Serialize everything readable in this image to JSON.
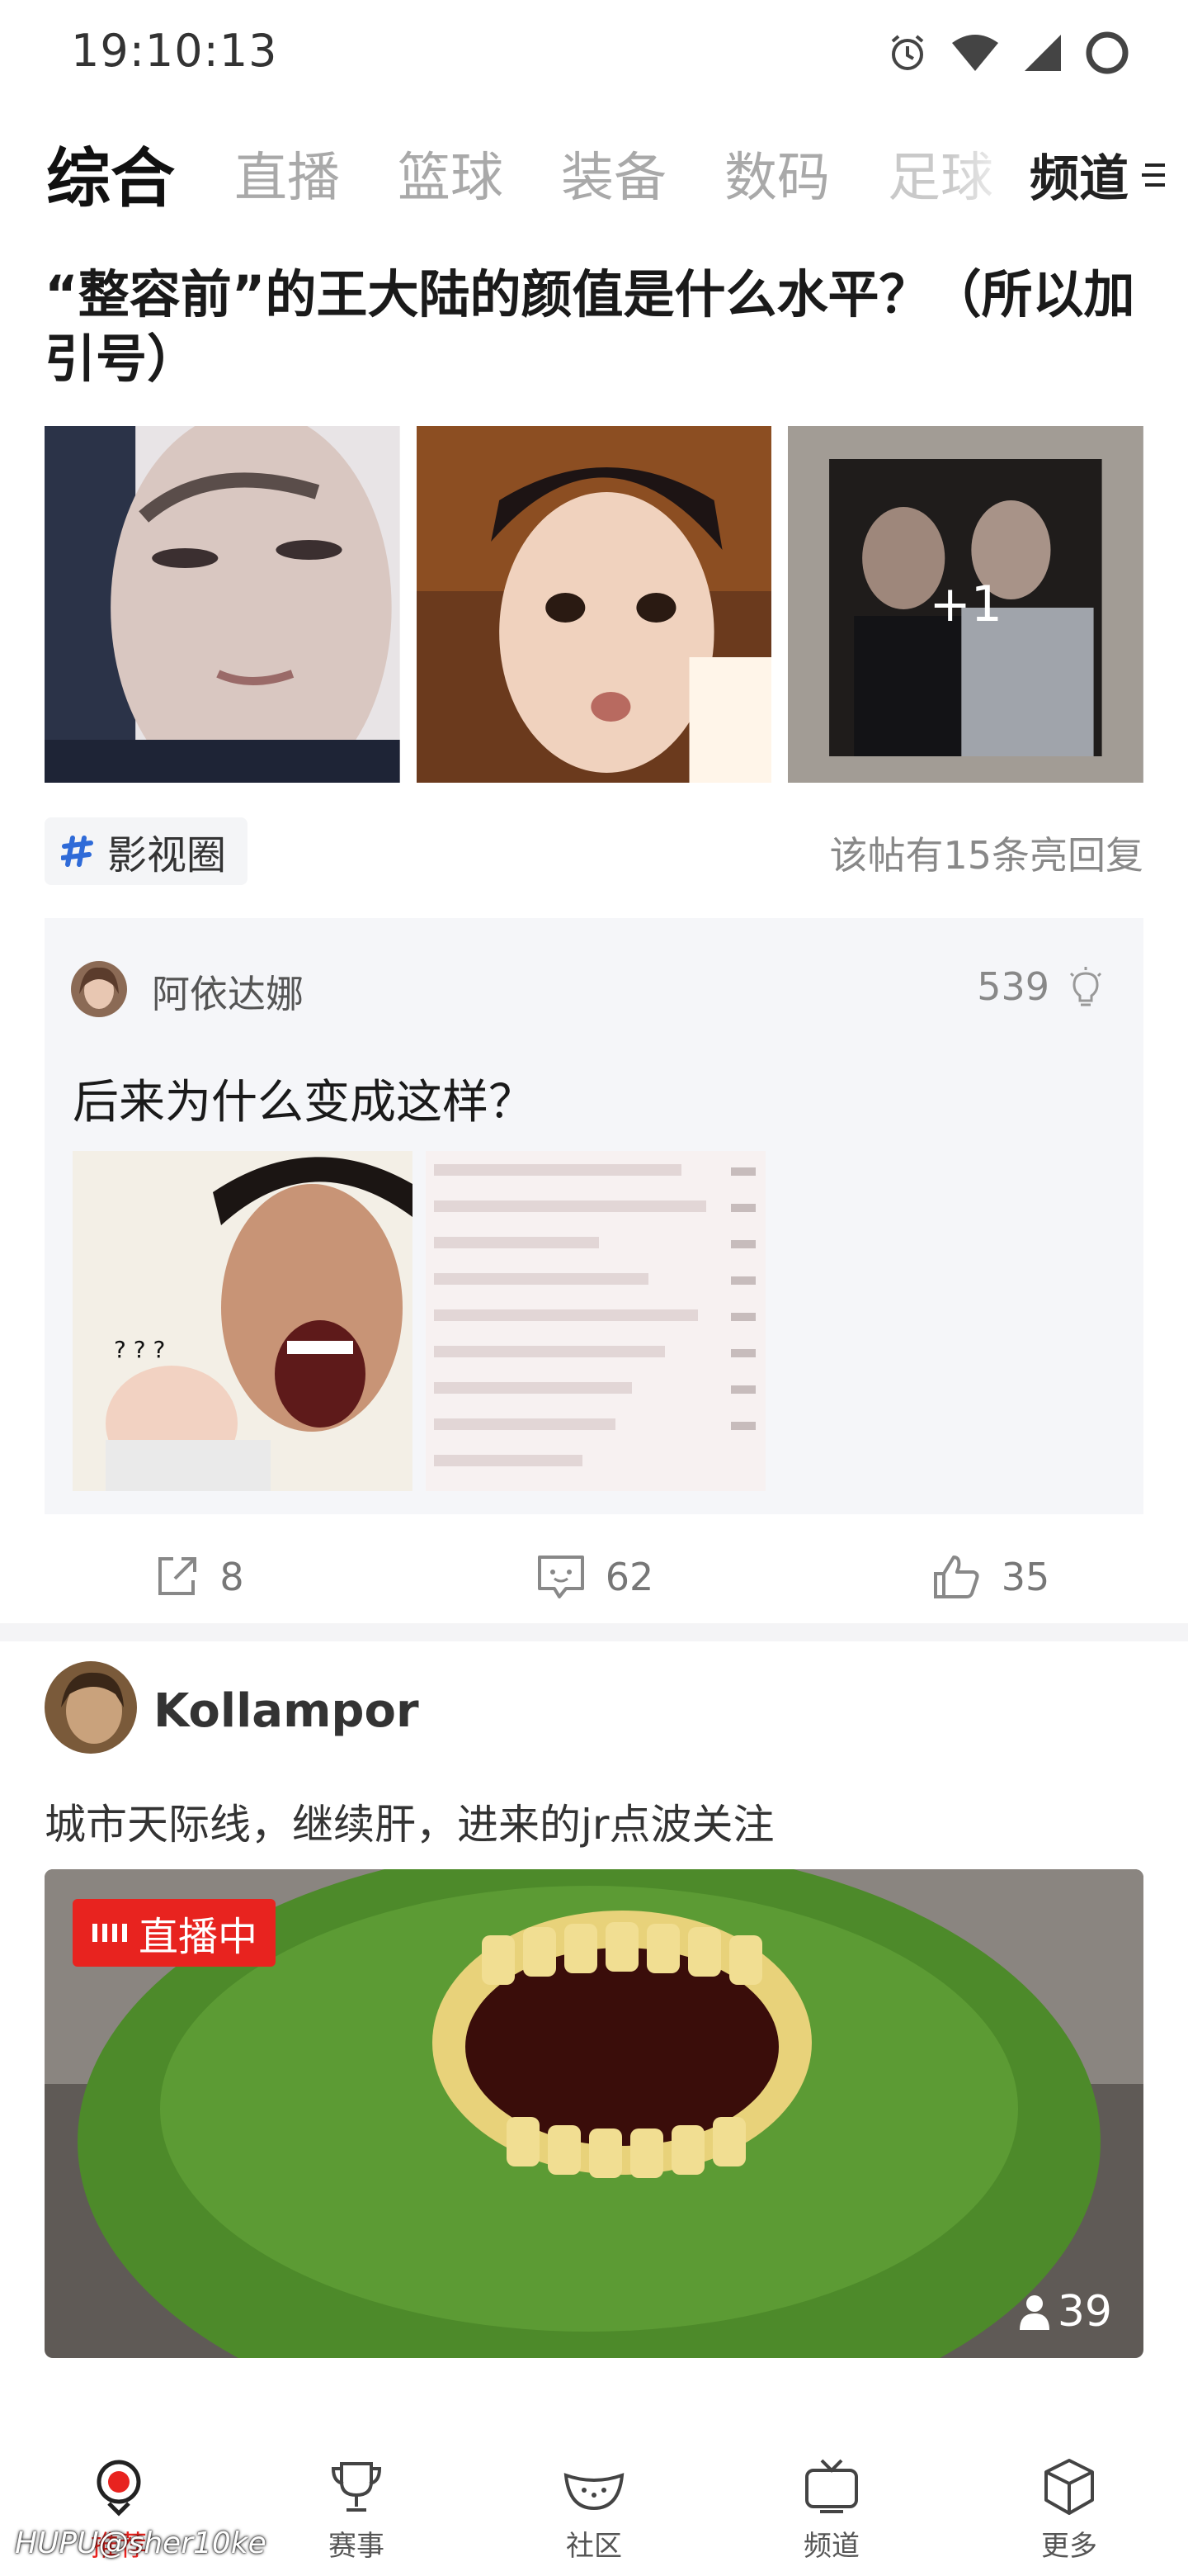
{
  "status_bar": {
    "time": "19:10:13"
  },
  "tabs": [
    {
      "label": "综合"
    },
    {
      "label": "直播"
    },
    {
      "label": "篮球"
    },
    {
      "label": "装备"
    },
    {
      "label": "数码"
    },
    {
      "label": "足球"
    }
  ],
  "channel_button": {
    "label": "频道"
  },
  "post1": {
    "title": "“整容前”的王大陆的颜值是什么水平？（所以加引号）",
    "more_images": "+1",
    "tag": "影视圈",
    "replies_note": "该帖有15条亮回复",
    "top_reply": {
      "user": "阿依达娜",
      "likes": "539",
      "text": "后来为什么变成这样？"
    },
    "actions": {
      "share": "8",
      "comment": "62",
      "like": "35"
    }
  },
  "post2": {
    "user": "Kollampor",
    "text": "城市天际线，继续肝，进来的jr点波关注",
    "live_badge": "直播中",
    "viewers": "39"
  },
  "bottom_nav": [
    {
      "label": "推荐",
      "icon": "hupu-logo-icon",
      "active": true
    },
    {
      "label": "赛事",
      "icon": "trophy-icon"
    },
    {
      "label": "社区",
      "icon": "watermelon-icon"
    },
    {
      "label": "频道",
      "icon": "tv-icon"
    },
    {
      "label": "更多",
      "icon": "cube-icon"
    }
  ],
  "watermark": "HUPU@sher10ke",
  "colors": {
    "accent": "#e8231f",
    "tag_icon": "#2f6bd8"
  }
}
